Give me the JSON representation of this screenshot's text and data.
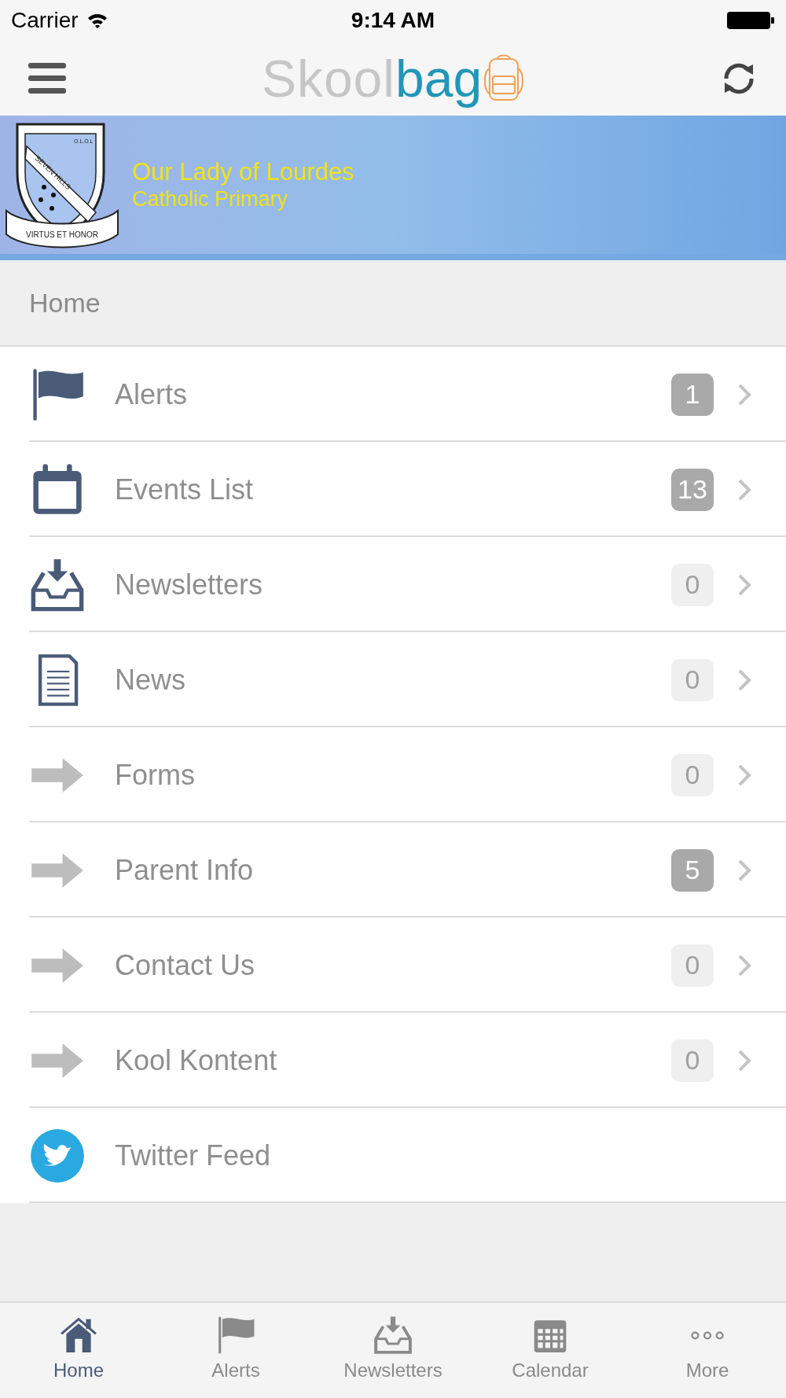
{
  "status_bar": {
    "carrier": "Carrier",
    "time": "9:14 AM"
  },
  "nav_bar": {
    "logo": {
      "part_1": "Skool",
      "part_2": "bag"
    }
  },
  "banner": {
    "crest": {
      "top": "O.L.O.L",
      "band": "SEVEN HILLS",
      "motto": "VIRTUS ET HONOR"
    },
    "title": "Our Lady of Lourdes",
    "subtitle": "Catholic Primary"
  },
  "section_header": "Home",
  "menu_items": [
    {
      "kind": "flag",
      "label": "Alerts",
      "badge": "1",
      "dimmed": false
    },
    {
      "kind": "calendar",
      "label": "Events List",
      "badge": "13",
      "dimmed": false
    },
    {
      "kind": "inbox",
      "label": "Newsletters",
      "badge": "0",
      "dimmed": true
    },
    {
      "kind": "document",
      "label": "News",
      "badge": "0",
      "dimmed": true
    },
    {
      "kind": "arrow",
      "label": "Forms",
      "badge": "0",
      "dimmed": true
    },
    {
      "kind": "arrow",
      "label": "Parent Info",
      "badge": "5",
      "dimmed": false
    },
    {
      "kind": "arrow",
      "label": "Contact Us",
      "badge": "0",
      "dimmed": true
    },
    {
      "kind": "arrow",
      "label": "Kool Kontent",
      "badge": "0",
      "dimmed": true
    },
    {
      "kind": "twitter",
      "label": "Twitter Feed"
    }
  ],
  "tab_bar": [
    {
      "kind": "home",
      "label": "Home",
      "selected": true
    },
    {
      "kind": "flag",
      "label": "Alerts",
      "selected": false
    },
    {
      "kind": "inbox",
      "label": "Newsletters",
      "selected": false
    },
    {
      "kind": "calendar",
      "label": "Calendar",
      "selected": false
    },
    {
      "kind": "more",
      "label": "More",
      "selected": false
    }
  ]
}
